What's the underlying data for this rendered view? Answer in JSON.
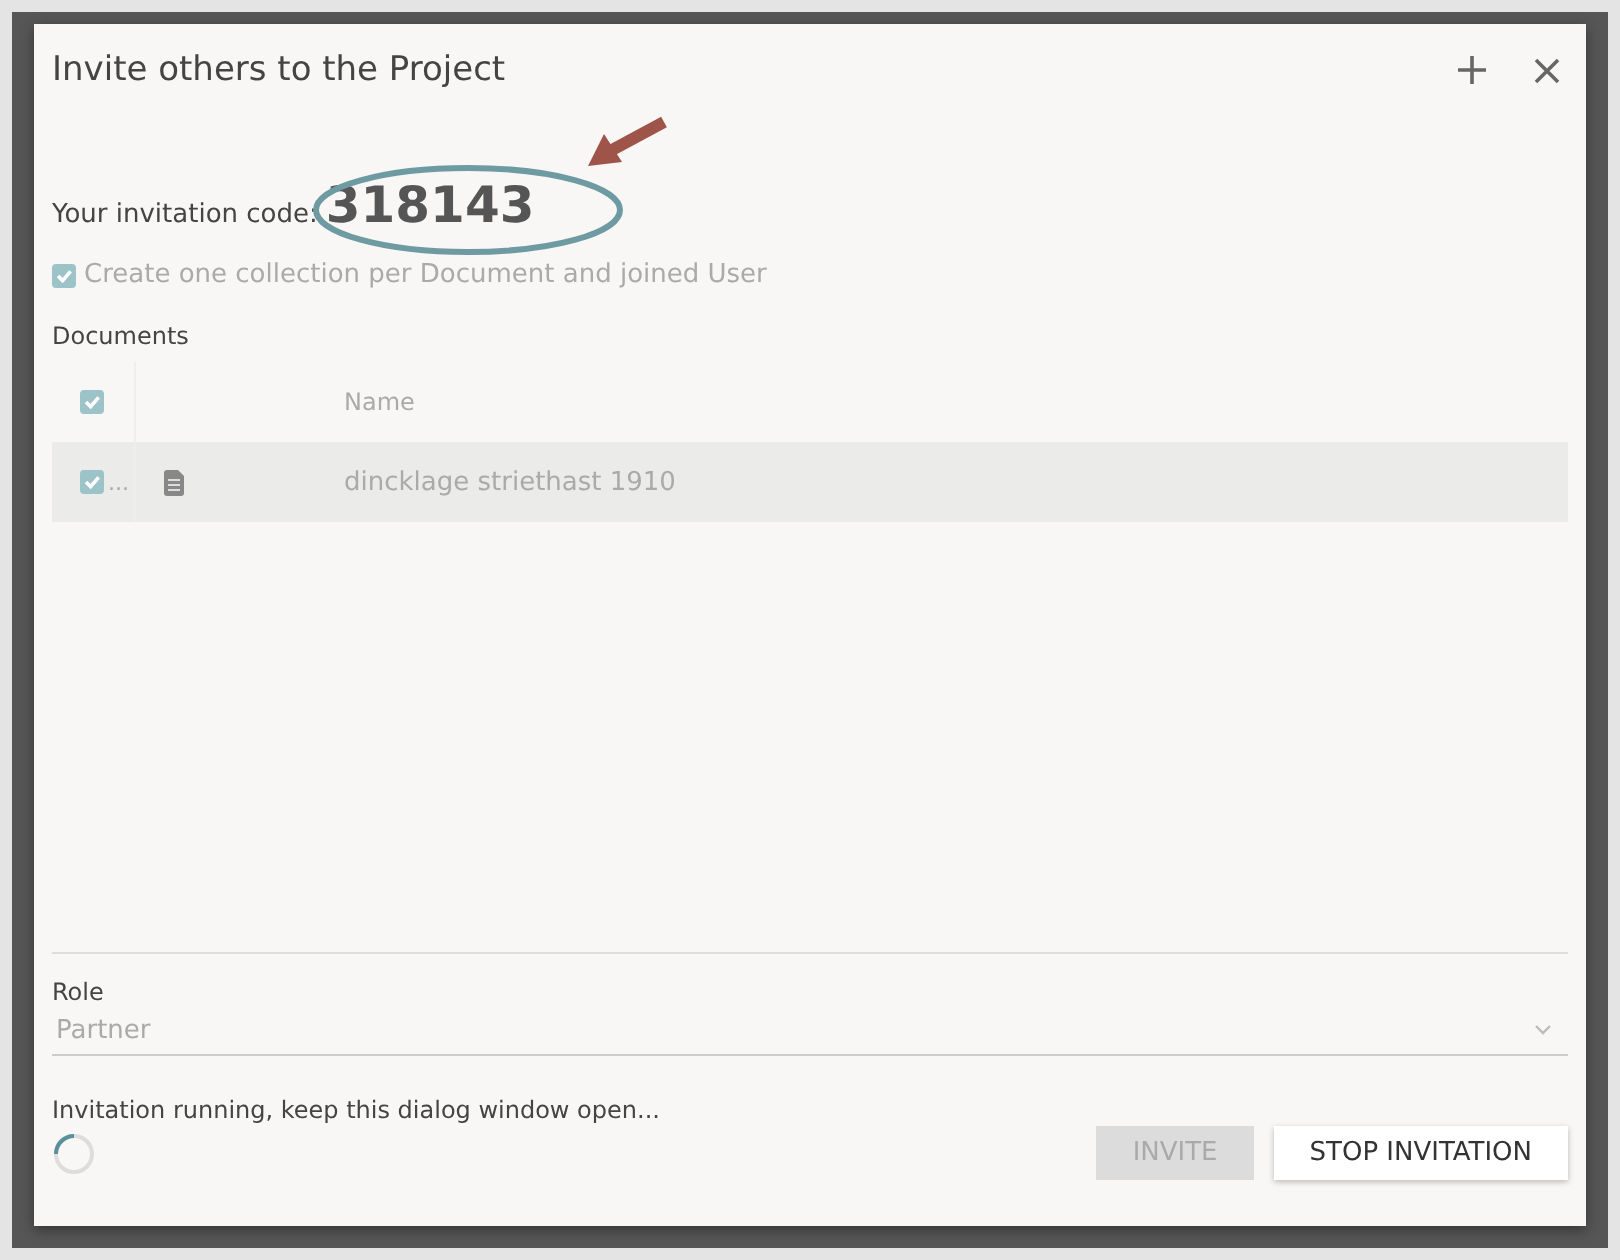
{
  "dialog": {
    "title": "Invite others to the Project",
    "code_label": "Your invitation code:",
    "code": "318143",
    "collection_option": {
      "label": "Create one collection per Document and joined User",
      "checked": true
    },
    "documents": {
      "label": "Documents",
      "all_checked": true,
      "columns": [
        "Name"
      ],
      "rows": [
        {
          "menu": "...",
          "name": "dincklage striethast 1910",
          "checked": true,
          "selected": true
        }
      ]
    },
    "role": {
      "label": "Role",
      "value": "Partner"
    },
    "status": "Invitation running, keep this dialog window open...",
    "buttons": [
      {
        "label": "INVITE",
        "disabled": true
      },
      {
        "label": "STOP INVITATION",
        "disabled": false
      }
    ]
  }
}
